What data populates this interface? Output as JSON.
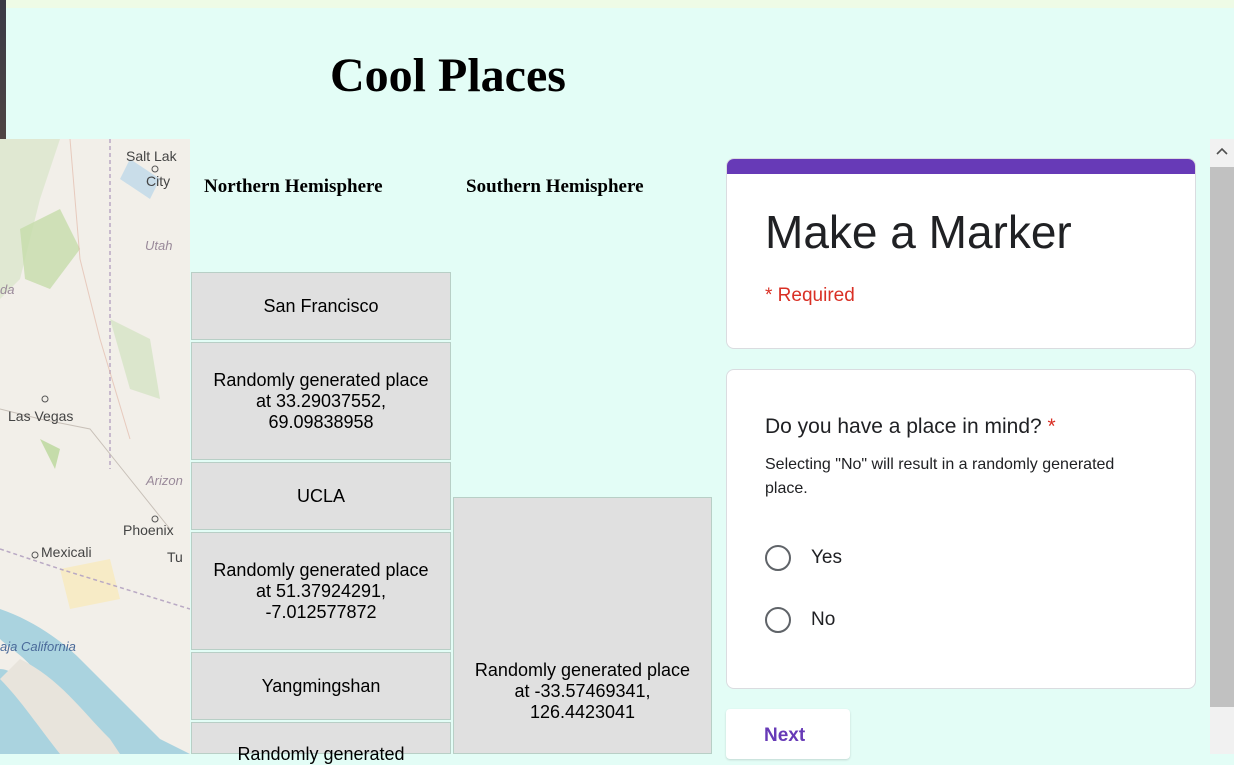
{
  "page": {
    "title": "Cool Places",
    "accent_color": "#673ab7",
    "background_color": "#e3fdf6"
  },
  "map": {
    "labels": {
      "salt_lake_city": "Salt Lake City",
      "utah": "Utah",
      "las_vegas": "Las Vegas",
      "arizona": "Arizona",
      "phoenix": "Phoenix",
      "mexicali": "Mexicali",
      "tucson": "Tu",
      "baja_california": "aja California",
      "nevada": "da"
    }
  },
  "table": {
    "headers": [
      "Northern Hemisphere",
      "Southern Hemisphere"
    ],
    "northern": [
      "San Francisco",
      "Randomly generated place at 33.29037552, 69.09838958",
      "UCLA",
      "Randomly generated place at 51.37924291, -7.012577872",
      "Yangmingshan",
      "Randomly generated"
    ],
    "southern": [
      "Randomly generated place at -33.57469341, 126.4423041"
    ]
  },
  "form": {
    "title": "Make a Marker",
    "required_note": "* Required",
    "question": {
      "text": "Do you have a place in mind?",
      "required_mark": "*",
      "help": "Selecting \"No\" will result in a randomly generated place.",
      "options": [
        "Yes",
        "No"
      ]
    },
    "next_label": "Next"
  },
  "scrollbar": {
    "up_icon": "chevron-up-icon"
  }
}
